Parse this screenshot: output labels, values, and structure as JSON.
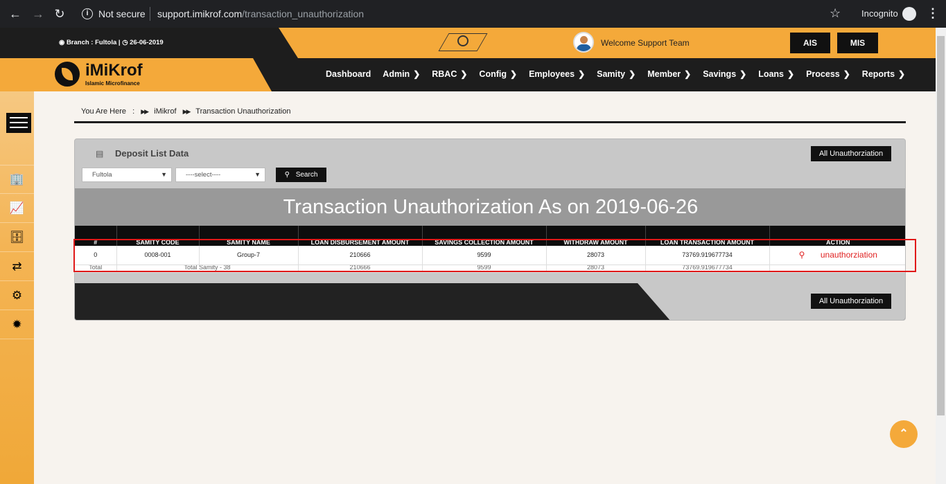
{
  "browser": {
    "security_label": "Not secure",
    "url_host": "support.imikrof.com",
    "url_path": "/transaction_unauthorization",
    "incognito_label": "Incognito"
  },
  "topbar": {
    "branch_text": "Branch : Fultola |",
    "date_text": "26-06-2019",
    "welcome_text": "Welcome Support Team",
    "buttons": [
      "AIS",
      "MIS"
    ]
  },
  "logo": {
    "title": "iMiKrof",
    "subtitle": "Islamic Microfinance"
  },
  "nav": {
    "items": [
      {
        "label": "Dashboard",
        "has_sub": false
      },
      {
        "label": "Admin",
        "has_sub": true
      },
      {
        "label": "RBAC",
        "has_sub": true
      },
      {
        "label": "Config",
        "has_sub": true
      },
      {
        "label": "Employees",
        "has_sub": true
      },
      {
        "label": "Samity",
        "has_sub": true
      },
      {
        "label": "Member",
        "has_sub": true
      },
      {
        "label": "Savings",
        "has_sub": true
      },
      {
        "label": "Loans",
        "has_sub": true
      },
      {
        "label": "Process",
        "has_sub": true
      },
      {
        "label": "Reports",
        "has_sub": true
      }
    ]
  },
  "sidebar": {
    "icons": [
      "building-icon",
      "chart-icon",
      "cashier-icon",
      "exchange-icon",
      "gears-icon",
      "network-icon"
    ]
  },
  "breadcrumb": {
    "prefix": "You Are Here",
    "colon": ":",
    "items": [
      "iMikrof",
      "Transaction Unauthorization"
    ]
  },
  "panel": {
    "title": "Deposit List Data",
    "all_button": "All Unauthorziation",
    "branch_select": "Fultola",
    "samity_select": "----select----",
    "search_button": "Search",
    "banner": "Transaction Unauthorization As on 2019-06-26"
  },
  "table": {
    "headers": [
      "#",
      "SAMITY CODE",
      "SAMITY NAME",
      "LOAN DISBURSEMENT AMOUNT",
      "SAVINGS COLLECTION AMOUNT",
      "WITHDRAW AMOUNT",
      "LOAN TRANSACTION AMOUNT",
      "ACTION"
    ],
    "rows": [
      {
        "index": "0",
        "code": "0008-001",
        "name": "Group-7",
        "loan_disb": "210666",
        "savings": "9599",
        "withdraw": "28073",
        "loan_trans": "73769.919677734",
        "action": "unauthorziation"
      }
    ],
    "total": {
      "label": "Total",
      "samity": "Total Samity - 38",
      "loan_disb": "210666",
      "savings": "9599",
      "withdraw": "28073",
      "loan_trans": "73769.919677734"
    }
  },
  "colors": {
    "accent": "#f4a93a",
    "dark": "#1d1d1d",
    "highlight": "#e01818"
  }
}
